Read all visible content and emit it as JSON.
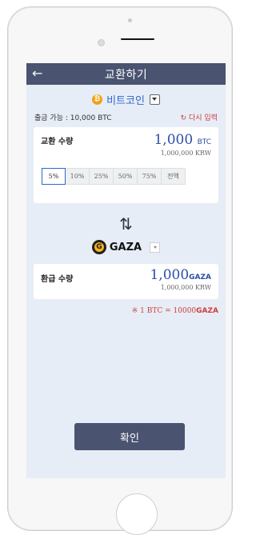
{
  "header": {
    "back_icon": "arrow-left-icon",
    "title": "교환하기"
  },
  "from_coin": {
    "icon": "bitcoin-icon",
    "name": "비트코인"
  },
  "available": {
    "label": "출금 가능 : 10,000 BTC",
    "reset": "다시 입력"
  },
  "exchange": {
    "label": "교환 수량",
    "amount": "1,000",
    "unit": "BTC",
    "krw": "1,000,000 KRW",
    "percents": [
      "5%",
      "10%",
      "25%",
      "50%",
      "75%",
      "전액"
    ],
    "selected_percent": "5%"
  },
  "swap_icon": "swap-arrows-icon",
  "to_coin": {
    "icon": "gaza-icon",
    "letter": "G",
    "name": "GAZA"
  },
  "refund": {
    "label": "환급 수량",
    "amount": "1,000",
    "unit": "GAZA",
    "krw": "1,000,000 KRW"
  },
  "rate": {
    "prefix": "※ 1 BTC = 10000",
    "unit": "GAZA"
  },
  "confirm_label": "확인",
  "colors": {
    "header": "#4a5370",
    "accent": "#2c4fa3",
    "alert": "#d23c3c",
    "screen_bg": "#e6edf6"
  }
}
